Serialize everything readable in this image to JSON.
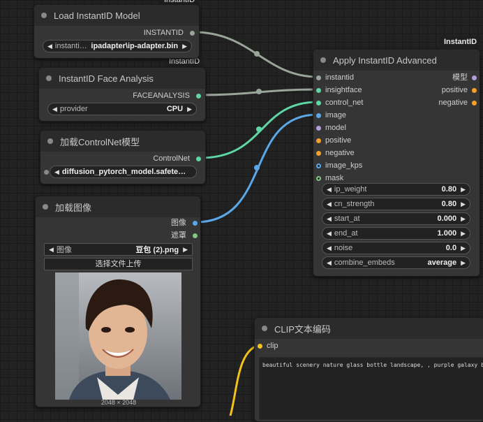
{
  "group_tags": {
    "top": "InstantID",
    "face": "InstantID",
    "apply": "InstantID"
  },
  "nodes": {
    "load_model": {
      "title": "Load InstantID Model",
      "output": "INSTANTID",
      "widget_label": "instantid...",
      "widget_value": "ipadapter\\ip-adapter.bin"
    },
    "face_analysis": {
      "title": "InstantID Face Analysis",
      "output": "FACEANALYSIS",
      "widget_label": "provider",
      "widget_value": "CPU"
    },
    "controlnet": {
      "title": "加载ControlNet模型",
      "output": "ControlNet",
      "widget_value": "diffusion_pytorch_model.safeten ..."
    },
    "load_image": {
      "title": "加载图像",
      "outputs": [
        "图像",
        "遮罩"
      ],
      "widget_label": "图像",
      "widget_value": "豆包 (2).png",
      "upload_label": "选择文件上传",
      "image_size": "2048 × 2048"
    },
    "apply": {
      "title": "Apply InstantID Advanced",
      "inputs": [
        "instantid",
        "insightface",
        "control_net",
        "image",
        "model",
        "positive",
        "negative",
        "image_kps",
        "mask"
      ],
      "outputs": [
        "模型",
        "positive",
        "negative"
      ],
      "widgets": [
        {
          "label": "ip_weight",
          "value": "0.80"
        },
        {
          "label": "cn_strength",
          "value": "0.80"
        },
        {
          "label": "start_at",
          "value": "0.000"
        },
        {
          "label": "end_at",
          "value": "1.000"
        },
        {
          "label": "noise",
          "value": "0.0"
        },
        {
          "label": "combine_embeds",
          "value": "average"
        }
      ]
    },
    "clip": {
      "title": "CLIP文本编码",
      "input": "clip",
      "text": "beautiful scenery nature glass bottle landscape, , purple galaxy bottle,"
    }
  },
  "colors": {
    "instantid_wire": "#9aa59a",
    "controlnet_wire": "#5ed6a5",
    "image_wire": "#5aa8e8",
    "clip_wire": "#f2c21a",
    "model_dot": "#b39ddb",
    "conditioning_dot": "#f5a02a",
    "mask_dot": "#81c784"
  },
  "icons": {
    "arrow_left": "◀",
    "arrow_right": "▶"
  }
}
